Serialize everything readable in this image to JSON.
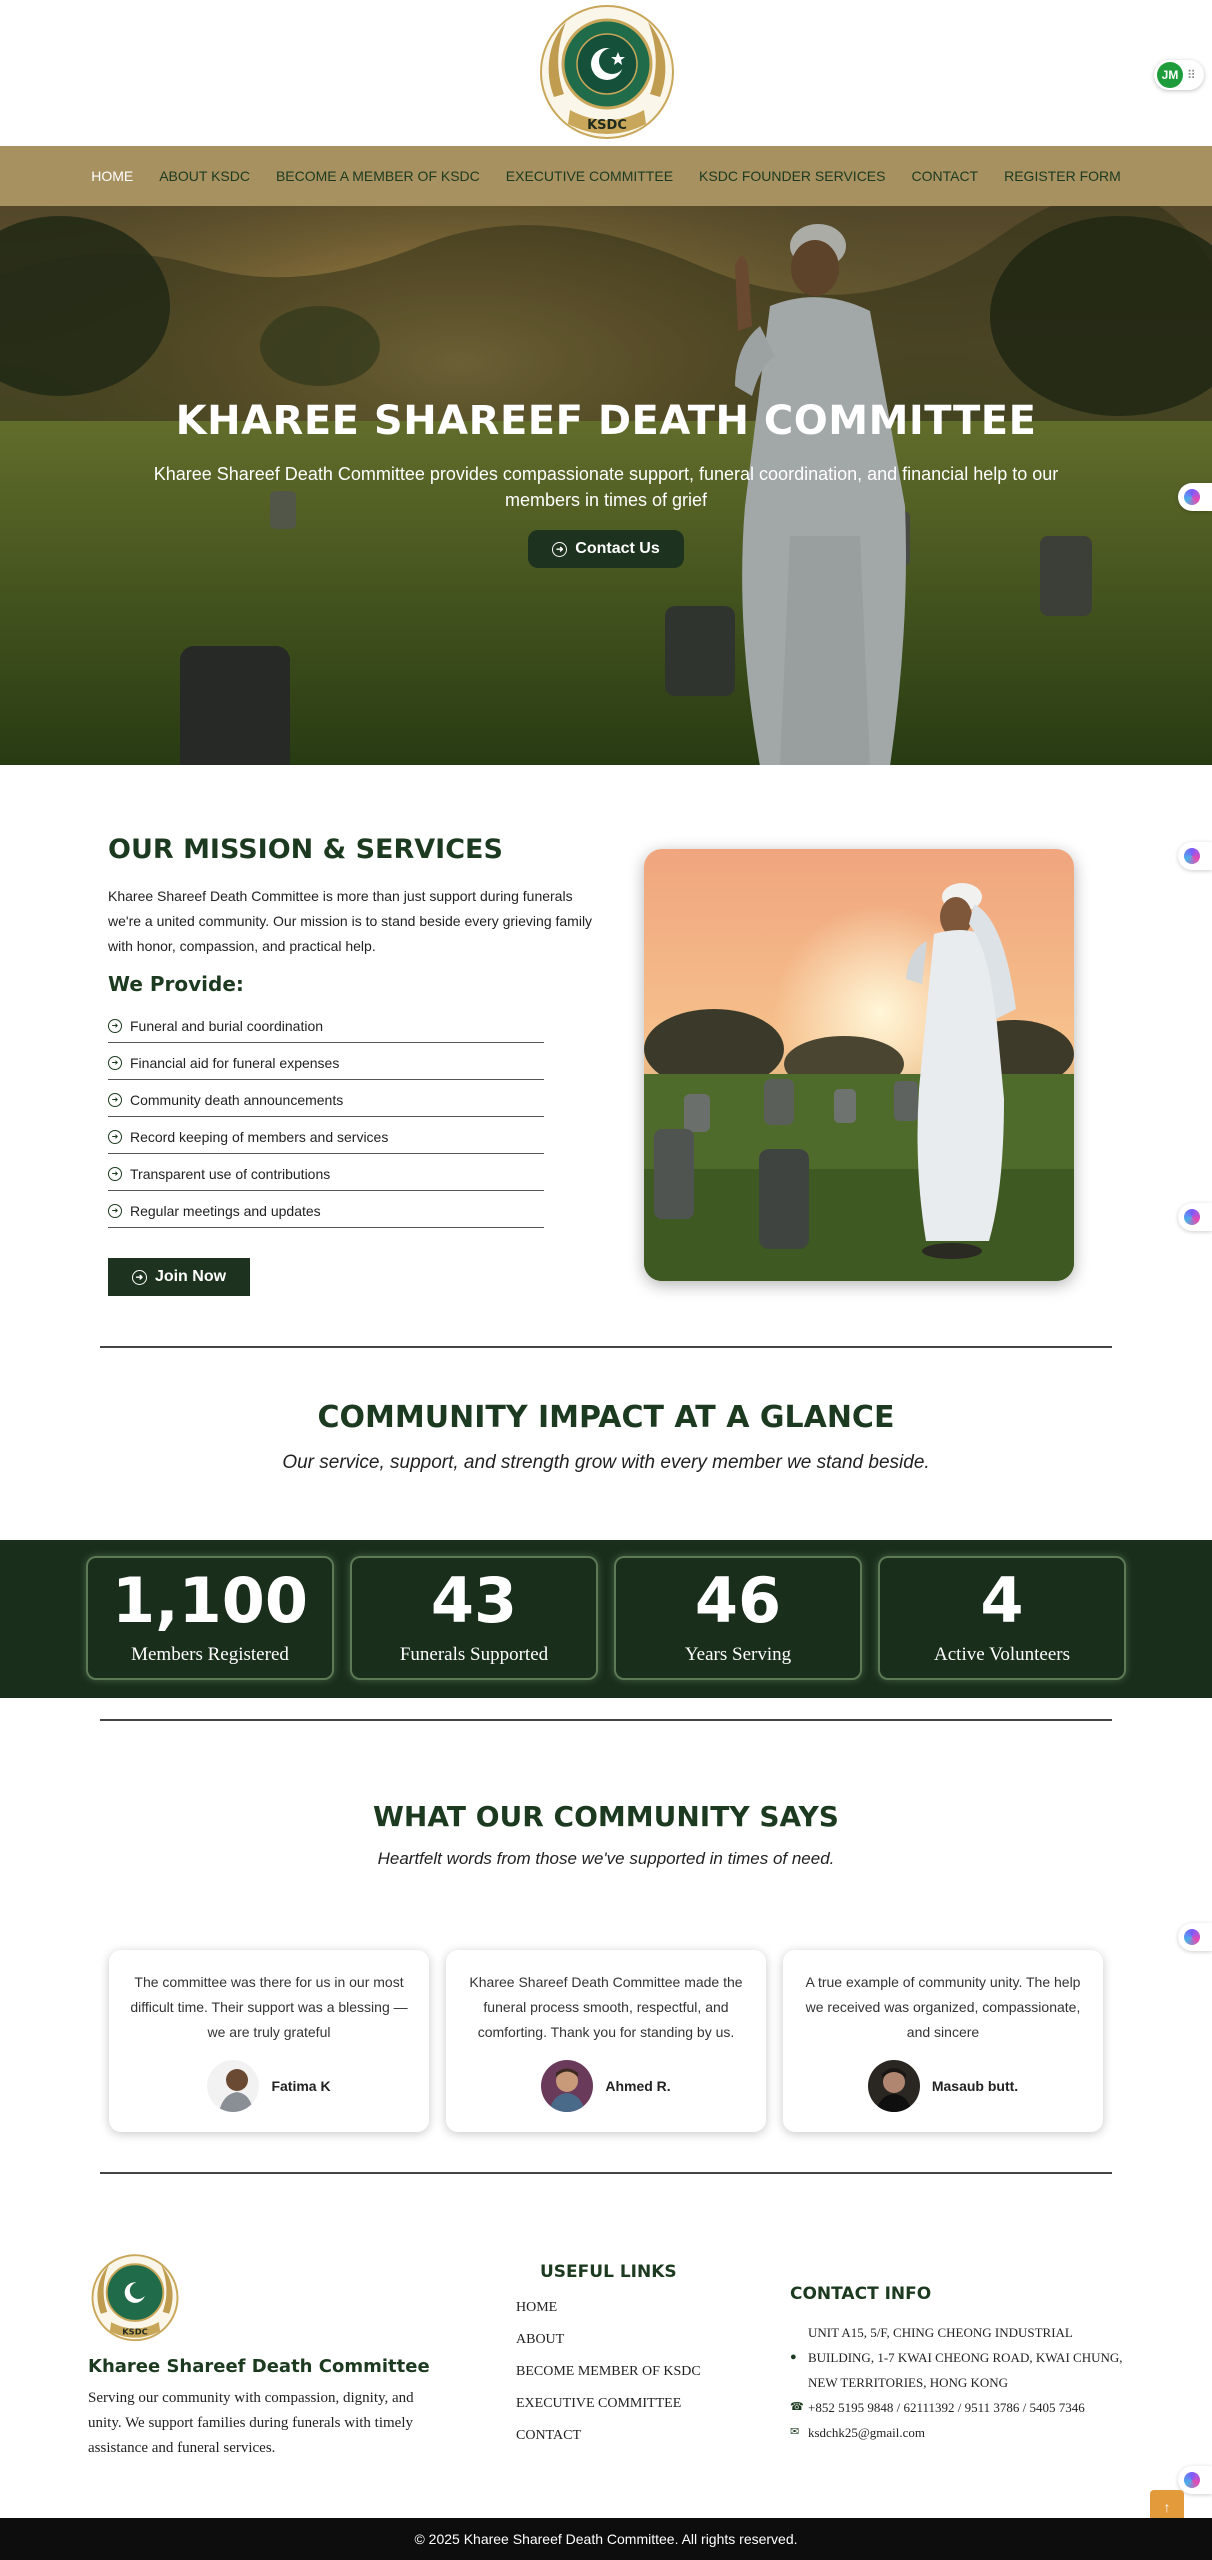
{
  "logo": {
    "text": "KSDC",
    "icon": "crescent-star-emblem"
  },
  "widget": {
    "badge": "JM"
  },
  "nav": {
    "items": [
      {
        "label": "HOME",
        "active": true
      },
      {
        "label": "ABOUT KSDC",
        "active": false
      },
      {
        "label": "BECOME A MEMBER OF KSDC",
        "active": false
      },
      {
        "label": "EXECUTIVE COMMITTEE",
        "active": false
      },
      {
        "label": "KSDC FOUNDER SERVICES",
        "active": false
      },
      {
        "label": "CONTACT",
        "active": false
      },
      {
        "label": "REGISTER FORM",
        "active": false
      }
    ]
  },
  "hero": {
    "title": "KHAREE SHAREEF DEATH COMMITTEE",
    "subtitle": "Kharee Shareef Death Committee provides compassionate support, funeral coordination, and financial help to our members in times of grief",
    "button": "Contact Us"
  },
  "mission": {
    "title": "OUR MISSION & SERVICES",
    "text": "Kharee Shareef Death Committee is more than just support during funerals we're a united community. Our mission is to stand beside every grieving family with honor, compassion, and practical help.",
    "provide_title": "We Provide:",
    "items": [
      "Funeral and burial coordination",
      "Financial aid for funeral expenses",
      "Community death announcements",
      "Record keeping of members and services",
      "Transparent use of contributions",
      "Regular meetings and updates"
    ],
    "button": "Join Now"
  },
  "impact": {
    "title": "COMMUNITY IMPACT AT A GLANCE",
    "subtitle": "Our service, support, and strength grow with every member we stand beside.",
    "stats": [
      {
        "value": "1,100",
        "label": "Members Registered"
      },
      {
        "value": "43",
        "label": "Funerals Supported"
      },
      {
        "value": "46",
        "label": "Years Serving"
      },
      {
        "value": "4",
        "label": "Active Volunteers"
      }
    ]
  },
  "testimonials": {
    "title": "WHAT OUR COMMUNITY SAYS",
    "subtitle": "Heartfelt words from those we've supported in times of need.",
    "cards": [
      {
        "quote": "The committee was there for us in our most difficult time. Their support was a blessing — we are truly grateful",
        "name": "Fatima K"
      },
      {
        "quote": "Kharee Shareef Death Committee made the funeral process smooth, respectful, and comforting. Thank you for standing by us.",
        "name": "Ahmed R."
      },
      {
        "quote": "A true example of community unity. The help we received was organized, compassionate, and sincere",
        "name": "Masaub butt."
      }
    ]
  },
  "footer": {
    "name": "Kharee Shareef Death Committee",
    "description": "Serving our community with compassion, dignity, and unity. We support families during funerals with timely assistance and funeral services.",
    "links_title": "USEFUL LINKS",
    "links": [
      "HOME",
      "ABOUT",
      "BECOME MEMBER OF KSDC",
      "EXECUTIVE COMMITTEE",
      "CONTACT"
    ],
    "contact_title": "CONTACT INFO",
    "address_line1": "UNIT A15, 5/F, CHING CHEONG INDUSTRIAL",
    "address_line2": "BUILDING, 1-7 KWAI CHEONG ROAD, KWAI CHUNG, NEW TERRITORIES, HONG KONG",
    "phone": "+852 5195 9848 / 62111392 / 9511 3786 / 5405 7346",
    "email": "ksdchk25@gmail.com",
    "copyright": "© 2025 Kharee Shareef Death Committee. All rights reserved."
  },
  "colors": {
    "brand_dark_green": "#1e331f",
    "nav_gold": "#a89160",
    "stats_bg": "#1a2e1c",
    "to_top_orange": "#e39a3a"
  }
}
